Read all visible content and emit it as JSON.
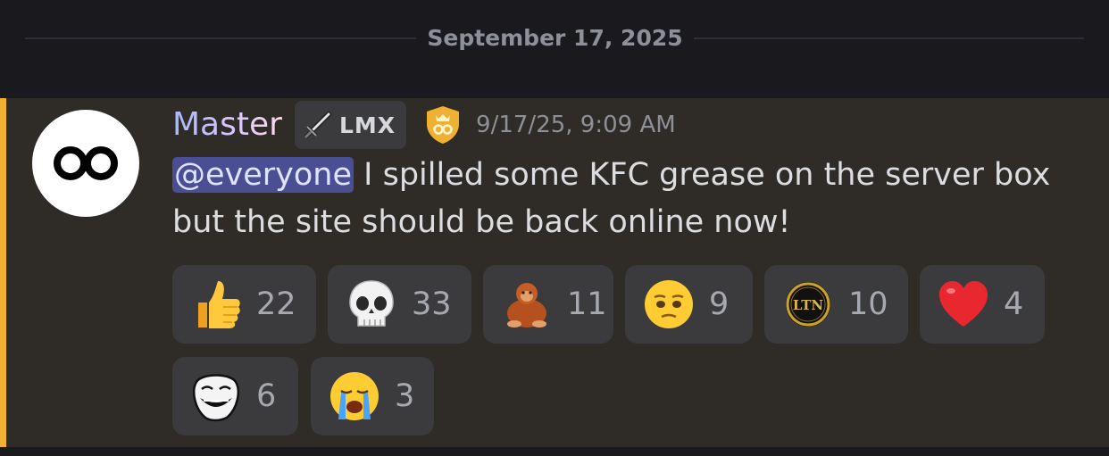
{
  "divider": {
    "date": "September 17, 2025"
  },
  "message": {
    "author": {
      "name": "Master",
      "tag": "LMX",
      "avatar_icon": "infinity-logo-icon",
      "badge_icon": "crown-shield-badge-icon"
    },
    "timestamp": "9/17/25, 9:09 AM",
    "mention": "@everyone",
    "text": " I spilled some KFC grease on the server box but the site should be back online now!"
  },
  "reactions": [
    {
      "emoji": "thumbs-up-icon",
      "count": "22"
    },
    {
      "emoji": "skull-icon",
      "count": "33"
    },
    {
      "emoji": "orangutan-icon",
      "count": "11"
    },
    {
      "emoji": "pleading-face-icon",
      "count": "9"
    },
    {
      "emoji": "ltn-coin-icon",
      "label": "LTN",
      "count": "10"
    },
    {
      "emoji": "red-heart-icon",
      "count": "4"
    },
    {
      "emoji": "trollface-icon",
      "count": "6"
    },
    {
      "emoji": "crying-face-icon",
      "count": "3"
    }
  ],
  "colors": {
    "mention_bar": "#f0b132",
    "highlight_bg": "#2f2c27",
    "mention_bg": "#4a4f94",
    "reaction_bg": "#3b3a3d"
  }
}
